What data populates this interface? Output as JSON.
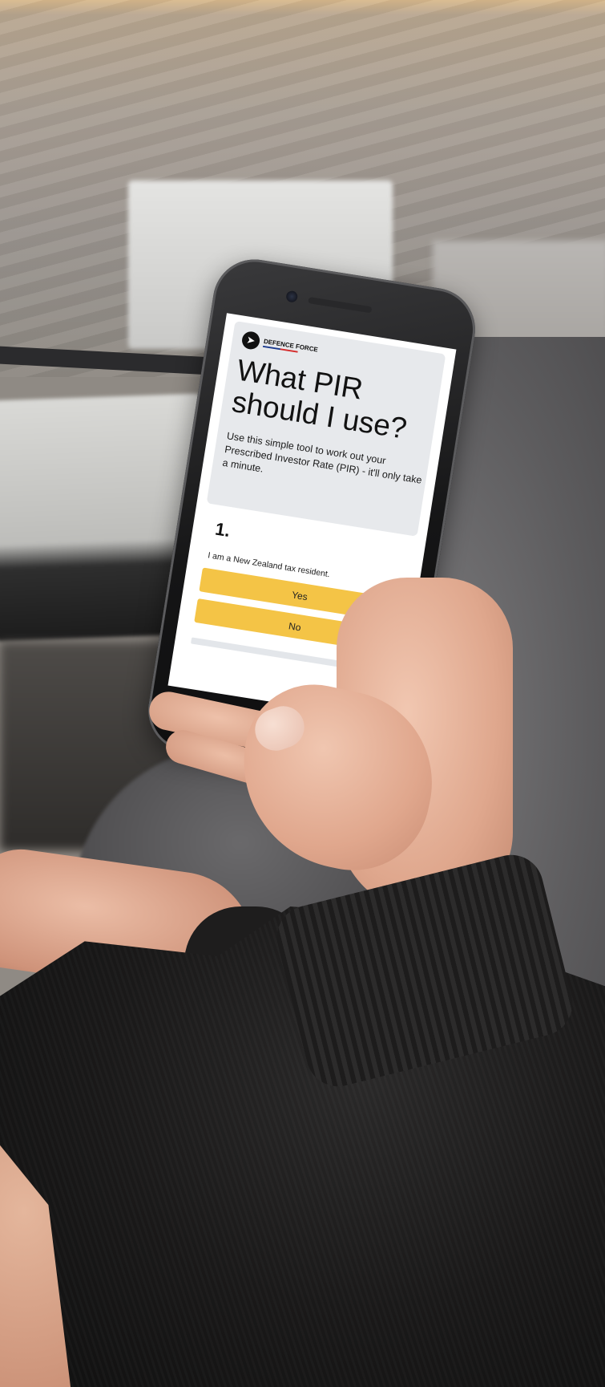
{
  "screen": {
    "logo": {
      "small_text": "",
      "brand": "DEFENCE FORCE"
    },
    "title": "What PIR should I use?",
    "intro": "Use this simple tool to work out your Prescribed Investor Rate (PIR) - it'll only take a minute.",
    "step_number": "1.",
    "question": "I am a New Zealand tax resident.",
    "answers": {
      "yes_label": "Yes",
      "no_label": "No"
    },
    "progress": 0
  },
  "colors": {
    "accent": "#f4c446",
    "hero_background": "#e7e9ec",
    "progress_track": "#e3e6ea"
  }
}
